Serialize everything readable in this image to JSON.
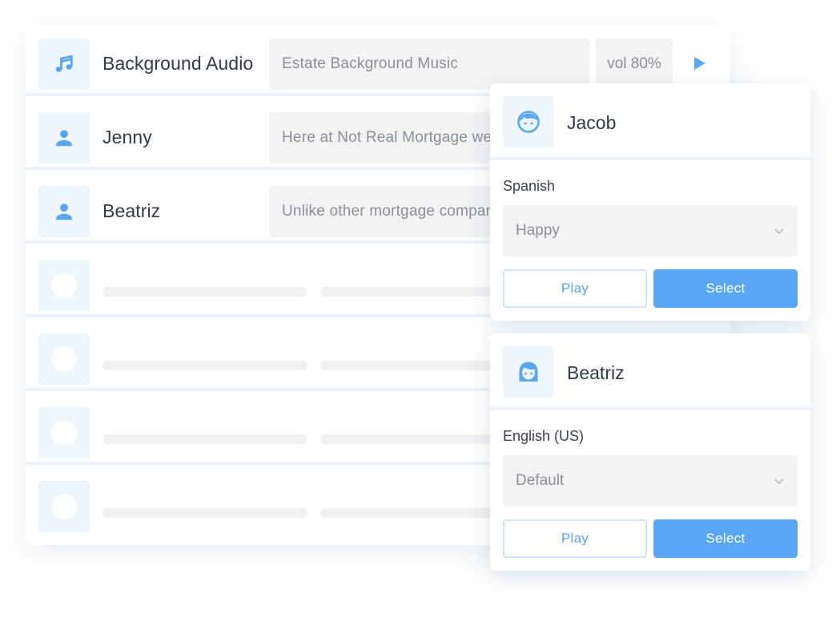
{
  "colors": {
    "accent": "#5aa6f4",
    "icon_blue": "#5aa6f0",
    "tile_bg": "#eef5fd",
    "field_bg": "#f3f3f4",
    "text_dark": "#343b48",
    "text_muted": "#8a8f99"
  },
  "list": {
    "rows": [
      {
        "icon": "music-note-icon",
        "name": "Background Audio",
        "text": "Estate Background Music",
        "volume": "vol 80%"
      },
      {
        "icon": "user-icon",
        "name": "Jenny",
        "text": "Here at Not Real Mortgage we are"
      },
      {
        "icon": "user-icon",
        "name": "Beatriz",
        "text": "Unlike other mortgage companies"
      }
    ],
    "placeholder_rows": 4
  },
  "voice_cards": [
    {
      "avatar_icon": "boy-face-icon",
      "name": "Jacob",
      "language": "Spanish",
      "style": "Happy",
      "play_label": "Play",
      "select_label": "Select"
    },
    {
      "avatar_icon": "girl-face-icon",
      "name": "Beatriz",
      "language": "English (US)",
      "style": "Default",
      "play_label": "Play",
      "select_label": "Select"
    }
  ]
}
